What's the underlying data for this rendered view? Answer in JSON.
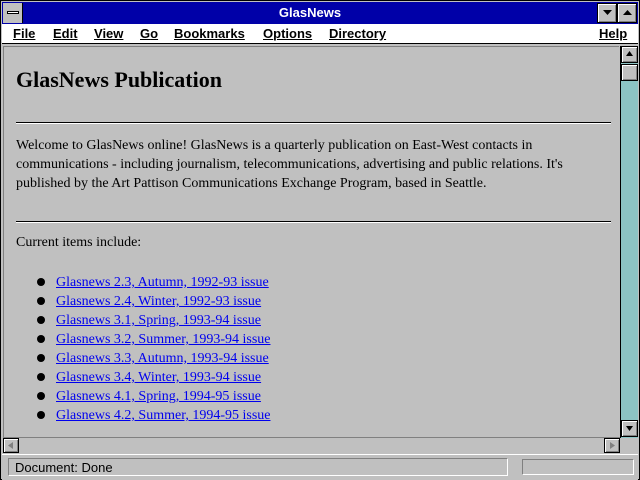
{
  "window": {
    "title": "GlasNews"
  },
  "menu": [
    "File",
    "Edit",
    "View",
    "Go",
    "Bookmarks",
    "Options",
    "Directory",
    "Help"
  ],
  "page": {
    "heading": "GlasNews Publication",
    "paragraph": "Welcome to GlasNews online! GlasNews is a quarterly publication on East-West contacts in communications - including journalism, telecommunications, advertising and public relations. It's published by the Art Pattison Communications Exchange Program, based in Seattle.",
    "intro": "Current items include:",
    "items": [
      "Glasnews 2.3, Autumn, 1992-93 issue",
      "Glasnews 2.4, Winter, 1992-93 issue",
      "Glasnews 3.1, Spring, 1993-94 issue",
      "Glasnews 3.2, Summer, 1993-94 issue",
      "Glasnews 3.3, Autumn, 1993-94 issue",
      "Glasnews 3.4, Winter, 1993-94 issue",
      "Glasnews 4.1, Spring, 1994-95 issue",
      "Glasnews 4.2, Summer, 1994-95 issue"
    ]
  },
  "status": {
    "text": "Document: Done"
  },
  "colors": {
    "titlebar": "#0000a8",
    "link": "#0000ee",
    "scroll_track": "#8cc4c4"
  }
}
